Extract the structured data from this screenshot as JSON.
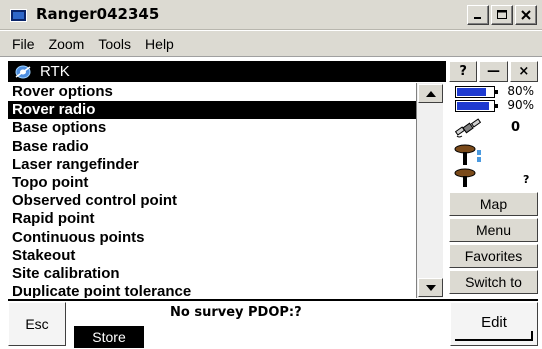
{
  "window": {
    "title": "Ranger042345",
    "controls": [
      "_",
      "□",
      "×"
    ]
  },
  "menu": [
    "File",
    "Zoom",
    "Tools",
    "Help"
  ],
  "panel": {
    "title": "RTK",
    "help_label": "?",
    "minimize_label": "—",
    "close_label": "×"
  },
  "list": {
    "items": [
      "Rover options",
      "Rover radio",
      "Base options",
      "Base radio",
      "Laser rangefinder",
      "Topo point",
      "Observed control point",
      "Rapid point",
      "Continuous points",
      "Stakeout",
      "Site calibration",
      "Duplicate point tolerance"
    ],
    "selected_index": 1
  },
  "status": {
    "battery1_percent": "80%",
    "battery1_level": 0.8,
    "battery2_percent": "90%",
    "battery2_level": 0.9,
    "satellite_count": "0",
    "rover_status": "?",
    "icons": [
      "battery-icon",
      "battery-icon",
      "satellite-icon",
      "base-station-icon",
      "rover-antenna-icon"
    ]
  },
  "side_buttons": {
    "map": "Map",
    "menu": "Menu",
    "favorites": "Favorites",
    "switch_to": "Switch to"
  },
  "bottom": {
    "esc": "Esc",
    "status_message": "No survey  PDOP:?",
    "store": "Store",
    "edit": "Edit"
  }
}
